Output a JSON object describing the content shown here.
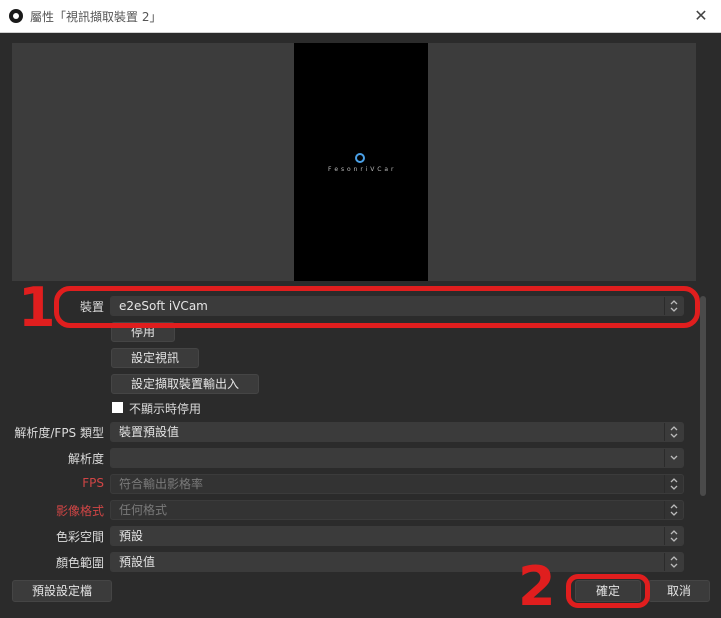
{
  "window": {
    "title": "屬性「視訊擷取裝置 2」",
    "close_glyph": "✕"
  },
  "preview": {
    "overlay_text": "F e s o n r i V C a r"
  },
  "props": {
    "device_label": "裝置",
    "device_value": "e2eSoft iVCam",
    "deactivate_button": "停用",
    "configure_video_button": "設定視訊",
    "configure_crossbar_button": "設定擷取裝置輸出入",
    "deactivate_when_hidden_label": "不顯示時停用",
    "resolution_fps_type_label": "解析度/FPS 類型",
    "resolution_fps_type_value": "裝置預設值",
    "resolution_label": "解析度",
    "resolution_value": "",
    "fps_label": "FPS",
    "fps_value": "符合輸出影格率",
    "video_format_label": "影像格式",
    "video_format_value": "任何格式",
    "color_space_label": "色彩空間",
    "color_space_value": "預設",
    "color_range_label": "顏色範圍",
    "color_range_value": "預設值"
  },
  "footer": {
    "defaults_button": "預設設定檔",
    "ok_button": "確定",
    "cancel_button": "取消"
  },
  "annotations": {
    "step1": "1",
    "step2": "2",
    "color": "#e01e1e"
  },
  "colors": {
    "background": "#2b2b2b",
    "control": "#3b3b3b",
    "disabled_label": "#d04545"
  },
  "icons": {
    "app_logo": "obs-logo-icon",
    "combo_arrow_updown": "⌃⌄",
    "combo_arrow_down": "⌄"
  }
}
